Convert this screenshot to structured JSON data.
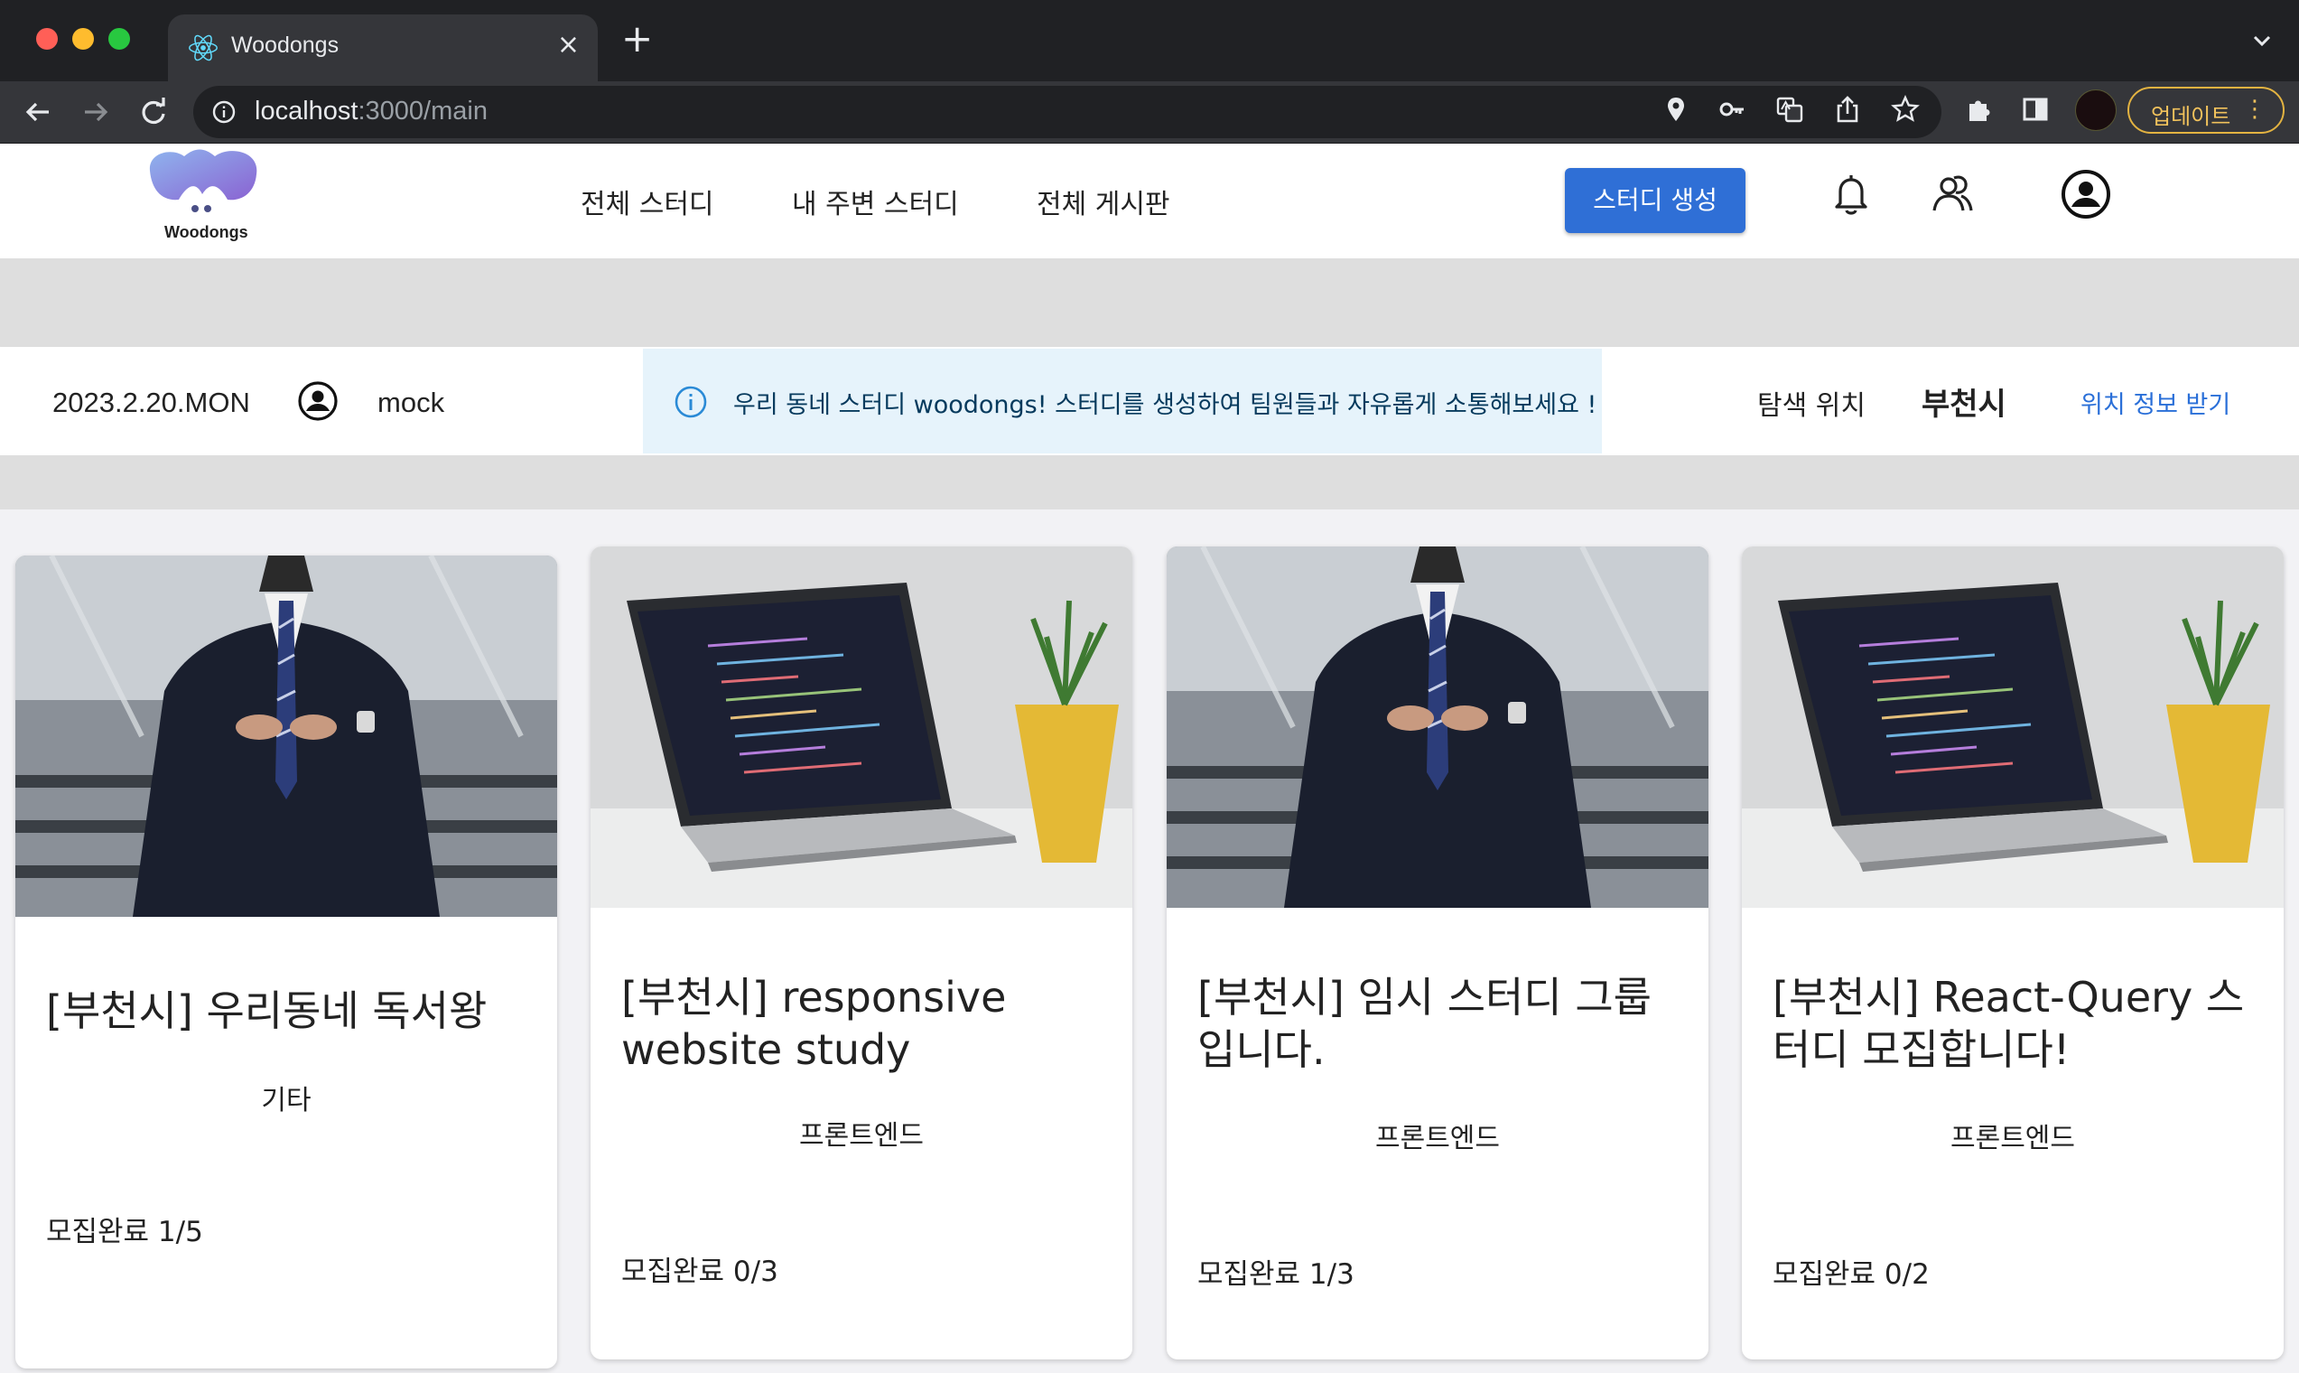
{
  "browser": {
    "tab_title": "Woodongs",
    "tab_close": "×",
    "new_tab": "+",
    "url_host": "localhost",
    "url_path": ":3000/main",
    "update_label": "업데이트",
    "update_menu": "⋮"
  },
  "header": {
    "logo_text": "Woodongs",
    "nav": [
      "전체 스터디",
      "내 주변 스터디",
      "전체 게시판"
    ],
    "create_button": "스터디 생성"
  },
  "info_bar": {
    "date": "2023.2.20.MON",
    "username": "mock",
    "notice": "우리 동네 스터디 woodongs! 스터디를 생성하여 팀원들과 자유롭게 소통해보세요 !",
    "location_label": "탐색 위치",
    "location_city": "부천시",
    "location_link": "위치 정보 받기"
  },
  "cards": [
    {
      "title": "[부천시] 우리동네 독서왕",
      "category": "기타",
      "status": "모집완료 1/5",
      "image": "suit"
    },
    {
      "title": "[부천시] responsive website study",
      "category": "프론트엔드",
      "status": "모집완료 0/3",
      "image": "laptop"
    },
    {
      "title": "[부천시] 임시 스터디 그룹입니다.",
      "category": "프론트엔드",
      "status": "모집완료 1/3",
      "image": "suit"
    },
    {
      "title": "[부천시] React-Query 스터디 모집합니다!",
      "category": "프론트엔드",
      "status": "모집완료 0/2",
      "image": "laptop"
    }
  ],
  "colors": {
    "accent": "#2f6fd6",
    "notice_bg": "#e6f3fb",
    "link": "#2a6fd8"
  }
}
